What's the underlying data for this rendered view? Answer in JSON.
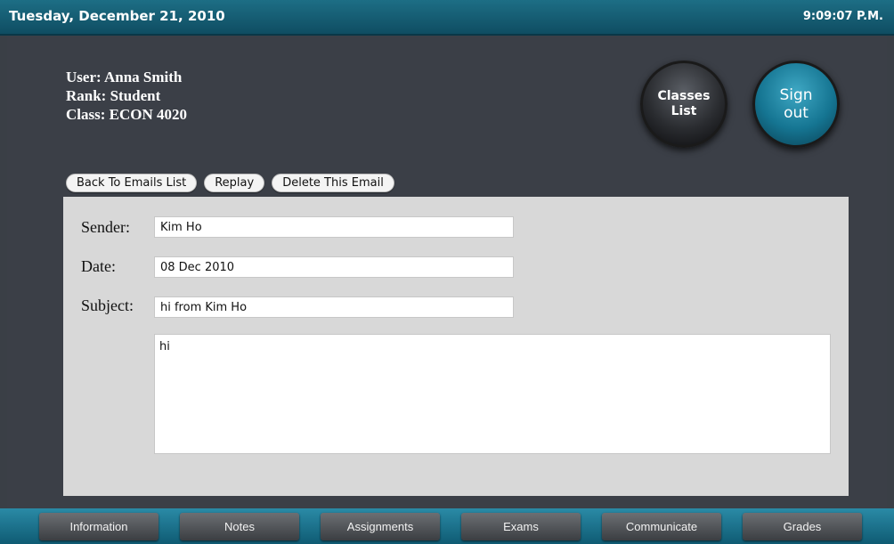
{
  "header": {
    "date": "Tuesday, December 21, 2010",
    "time": "9:09:07 P.M."
  },
  "user": {
    "user": "User: Anna Smith",
    "rank": "Rank: Student",
    "class": "Class: ECON 4020"
  },
  "buttons": {
    "classes_line1": "Classes",
    "classes_line2": "List",
    "signout_line1": "Sign",
    "signout_line2": "out"
  },
  "actions": {
    "back": "Back To Emails List",
    "replay": "Replay",
    "delete": "Delete This Email"
  },
  "email": {
    "sender_label": "Sender:",
    "sender": "Kim Ho",
    "date_label": "Date:",
    "date": "08 Dec 2010",
    "subject_label": "Subject:",
    "subject": "hi from Kim Ho",
    "body": "hi"
  },
  "nav": [
    "Information",
    "Notes",
    "Assignments",
    "Exams",
    "Communicate",
    "Grades"
  ],
  "colors": {
    "header": "#0f4d62",
    "panel": "#d8d8d8",
    "background": "#3b3f47",
    "accent": "#157592"
  }
}
